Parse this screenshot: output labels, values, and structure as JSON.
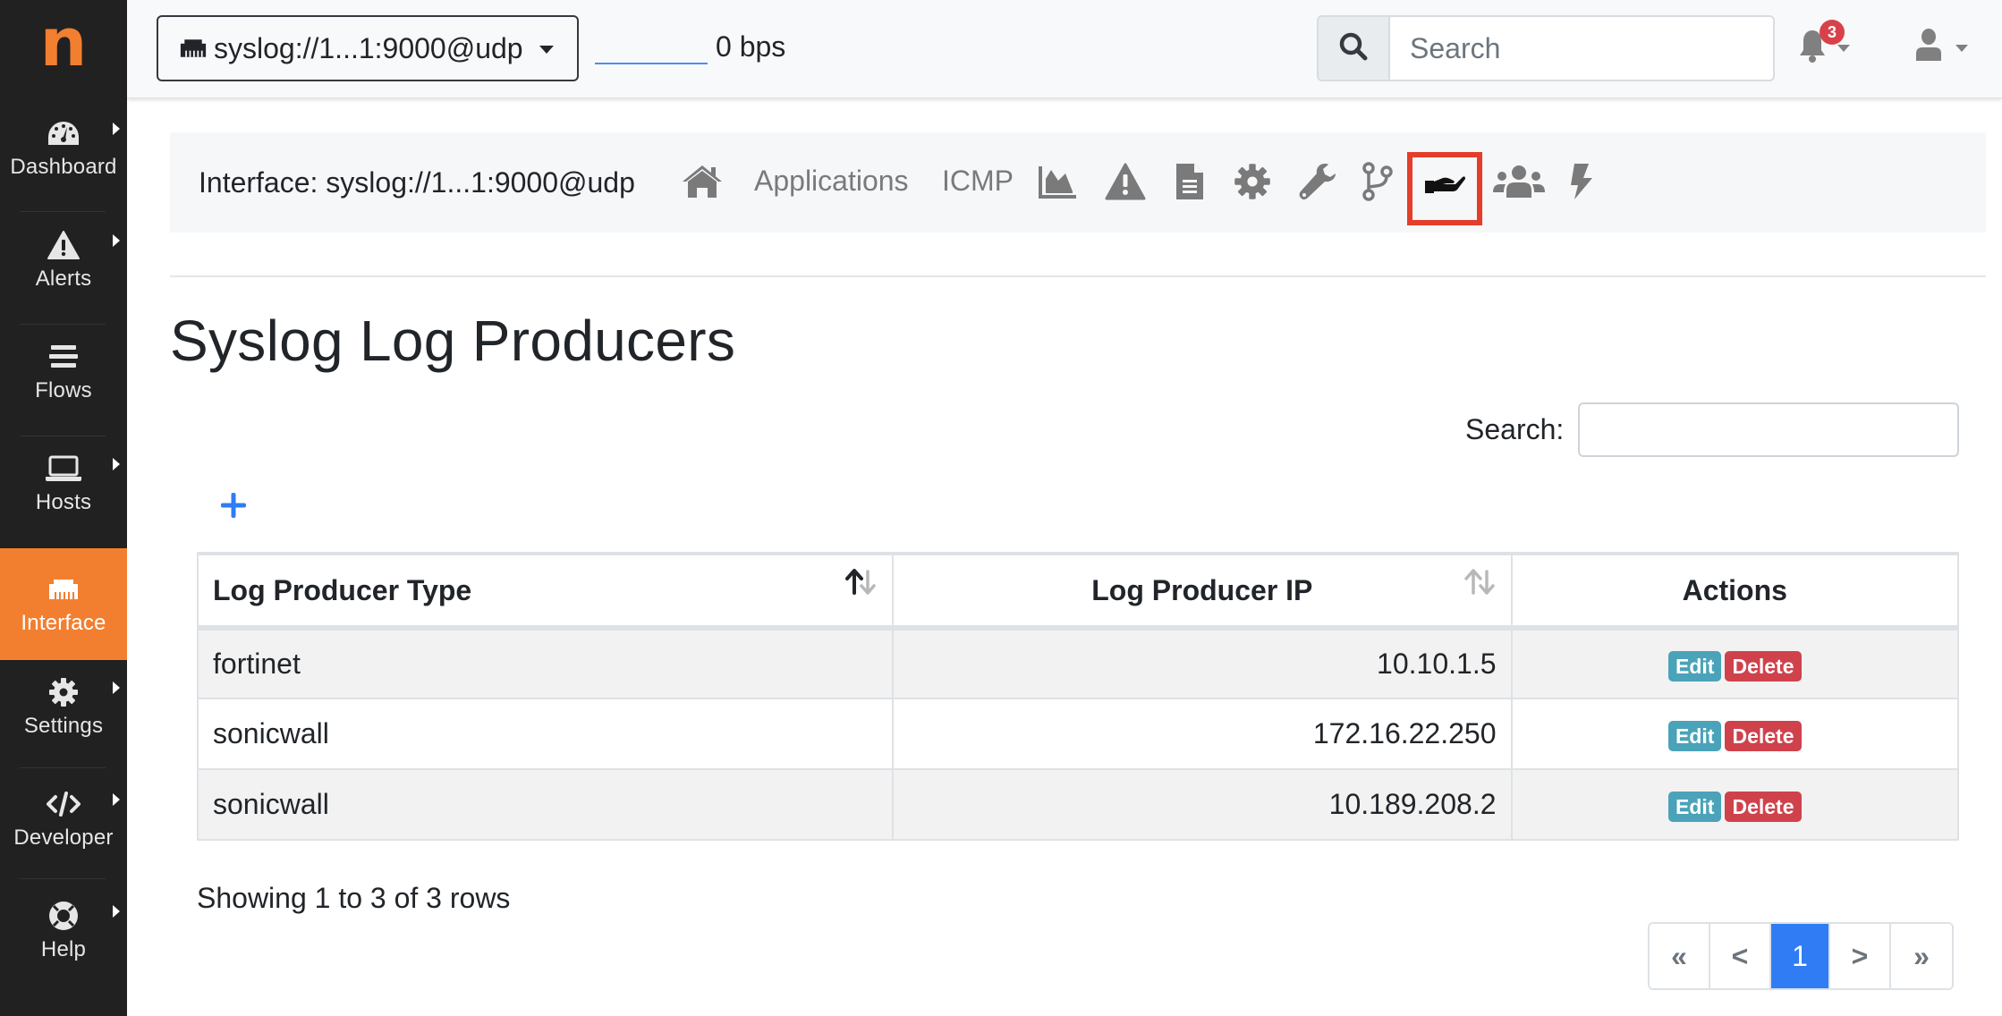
{
  "sidebar": {
    "logo": "n",
    "items": [
      {
        "label": "Dashboard",
        "icon": "dashboard-gauge-icon",
        "has_submenu": true,
        "active": false
      },
      {
        "label": "Alerts",
        "icon": "warning-triangle-icon",
        "has_submenu": true,
        "active": false
      },
      {
        "label": "Flows",
        "icon": "stream-bars-icon",
        "has_submenu": false,
        "active": false
      },
      {
        "label": "Hosts",
        "icon": "laptop-icon",
        "has_submenu": true,
        "active": false
      },
      {
        "label": "Interface",
        "icon": "ethernet-icon",
        "has_submenu": false,
        "active": true
      },
      {
        "label": "Settings",
        "icon": "gear-icon",
        "has_submenu": true,
        "active": false
      },
      {
        "label": "Developer",
        "icon": "code-icon",
        "has_submenu": true,
        "active": false
      },
      {
        "label": "Help",
        "icon": "life-ring-icon",
        "has_submenu": true,
        "active": false
      }
    ]
  },
  "topbar": {
    "interface_selector": "syslog://1...1:9000@udp",
    "throughput": "0 bps",
    "search_placeholder": "Search",
    "notifications_count": "3"
  },
  "interface_nav": {
    "title": "Interface: syslog://1...1:9000@udp",
    "links": [
      {
        "type": "icon",
        "name": "home-icon"
      },
      {
        "type": "text",
        "label": "Applications"
      },
      {
        "type": "text",
        "label": "ICMP"
      },
      {
        "type": "icon",
        "name": "area-chart-icon"
      },
      {
        "type": "icon",
        "name": "alert-triangle-icon"
      },
      {
        "type": "icon",
        "name": "file-icon"
      },
      {
        "type": "icon",
        "name": "gear-icon"
      },
      {
        "type": "icon",
        "name": "wrench-icon"
      },
      {
        "type": "icon",
        "name": "code-branch-icon"
      },
      {
        "type": "icon",
        "name": "hand-holding-icon",
        "active": true,
        "highlighted": true
      },
      {
        "type": "icon",
        "name": "users-icon"
      },
      {
        "type": "icon",
        "name": "bolt-icon"
      }
    ]
  },
  "page": {
    "title": "Syslog Log Producers",
    "search_label": "Search:",
    "search_value": ""
  },
  "table": {
    "columns": [
      {
        "label": "Log Producer Type",
        "sortable": true,
        "sort": "asc"
      },
      {
        "label": "Log Producer IP",
        "sortable": true,
        "sort": "none"
      },
      {
        "label": "Actions",
        "sortable": false
      }
    ],
    "rows": [
      {
        "type": "fortinet",
        "ip": "10.10.1.5",
        "edit": "Edit",
        "delete": "Delete"
      },
      {
        "type": "sonicwall",
        "ip": "172.16.22.250",
        "edit": "Edit",
        "delete": "Delete"
      },
      {
        "type": "sonicwall",
        "ip": "10.189.208.2",
        "edit": "Edit",
        "delete": "Delete"
      }
    ]
  },
  "footer": {
    "showing": "Showing 1 to 3 of 3 rows",
    "pagination": {
      "first": "«",
      "prev": "<",
      "current": "1",
      "next": ">",
      "last": "»"
    }
  },
  "colors": {
    "accent": "#f27f30",
    "sidebar_bg": "#212121",
    "primary": "#2f7cf5",
    "edit": "#4aa3b8",
    "delete": "#cf424c",
    "highlight": "#e43d2a"
  }
}
